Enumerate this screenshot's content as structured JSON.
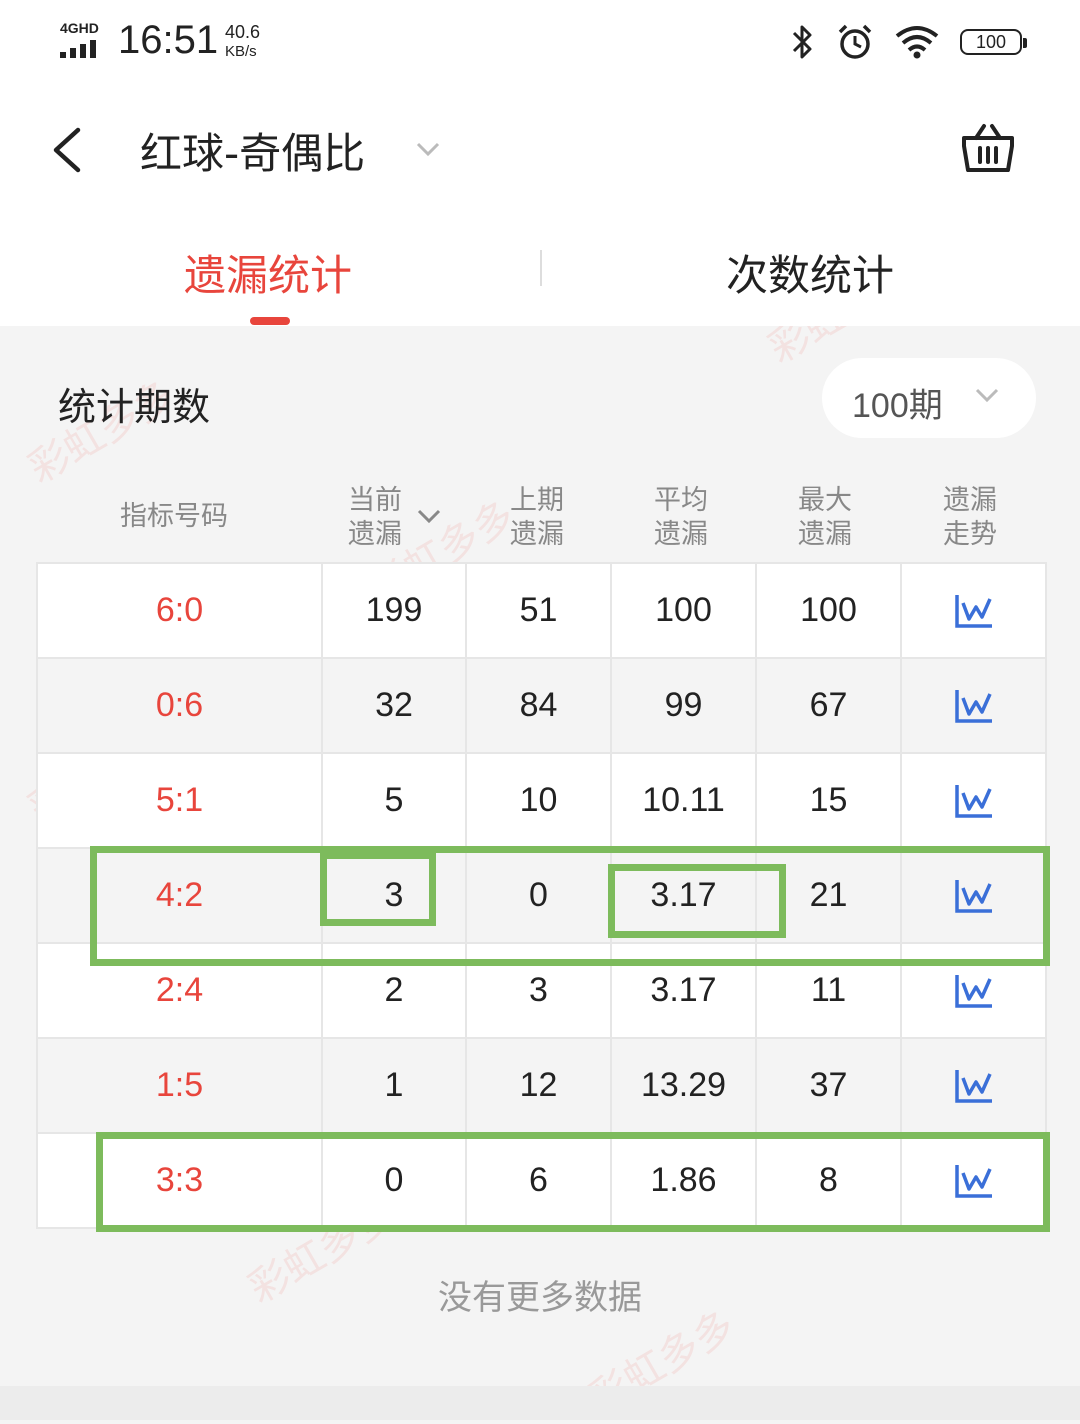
{
  "status_bar": {
    "network": "4GHD",
    "time": "16:51",
    "speed_value": "40.6",
    "speed_unit": "KB/s",
    "battery": "100"
  },
  "header": {
    "title": "红球-奇偶比"
  },
  "tabs": [
    {
      "label": "遗漏统计",
      "active": true
    },
    {
      "label": "次数统计",
      "active": false
    }
  ],
  "period": {
    "label": "统计期数",
    "value": "100期"
  },
  "table": {
    "headers": [
      {
        "line1": "指标号码",
        "line2": ""
      },
      {
        "line1": "当前",
        "line2": "遗漏"
      },
      {
        "line1": "上期",
        "line2": "遗漏"
      },
      {
        "line1": "平均",
        "line2": "遗漏"
      },
      {
        "line1": "最大",
        "line2": "遗漏"
      },
      {
        "line1": "遗漏",
        "line2": "走势"
      }
    ],
    "rows": [
      [
        "6:0",
        "199",
        "51",
        "100",
        "100"
      ],
      [
        "0:6",
        "32",
        "84",
        "99",
        "67"
      ],
      [
        "5:1",
        "5",
        "10",
        "10.11",
        "15"
      ],
      [
        "4:2",
        "3",
        "0",
        "3.17",
        "21"
      ],
      [
        "2:4",
        "2",
        "3",
        "3.17",
        "11"
      ],
      [
        "1:5",
        "1",
        "12",
        "13.29",
        "37"
      ],
      [
        "3:3",
        "0",
        "6",
        "1.86",
        "8"
      ]
    ]
  },
  "footer": {
    "no_more": "没有更多数据"
  },
  "watermark": "彩虹多多",
  "colors": {
    "accent": "#e8453c",
    "trend_icon": "#3a6fd8",
    "highlight_box": "#7dbb5c"
  }
}
